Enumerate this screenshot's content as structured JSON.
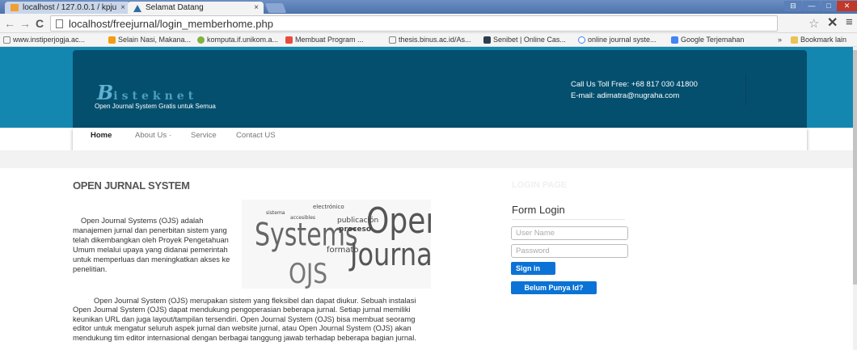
{
  "browser": {
    "tabs": [
      {
        "label": "localhost / 127.0.0.1 / kpju",
        "close": "×"
      },
      {
        "label": "Selamat Datang",
        "close": "×"
      }
    ],
    "window_controls": [
      "⊟",
      "—",
      "□",
      "✕"
    ],
    "url": "localhost/freejurnal/login_memberhome.php",
    "bookmarks": [
      {
        "label": "www.instiperjogja.ac...",
        "color": "#888888"
      },
      {
        "label": "Selain Nasi, Makana...",
        "color": "#f39c12"
      },
      {
        "label": "komputa.if.unikom.a...",
        "color": "#7cb342"
      },
      {
        "label": "Membuat Program ...",
        "color": "#e74c3c"
      },
      {
        "label": "thesis.binus.ac.id/As...",
        "color": "#888888"
      },
      {
        "label": "Senibet | Online Cas...",
        "color": "#2c3e50"
      },
      {
        "label": "online journal syste...",
        "color": "#4285f4"
      },
      {
        "label": "Google Terjemahan",
        "color": "#4285f4"
      }
    ],
    "bookmark_more": "»",
    "other_bookmarks": "Bookmark lain"
  },
  "header": {
    "logo_initial": "B",
    "logo_rest": "isteknet",
    "tagline": "Open Journal System Gratis untuk Semua",
    "phone": "Call Us Toll Free: +68 817 030 41800",
    "email": "E-mail: adimatra@nugraha.com"
  },
  "nav": {
    "home": "Home",
    "about": "About Us ·",
    "service": "Service",
    "contact": "Contact US"
  },
  "main": {
    "title": "OPEN JURNAL SYSTEM",
    "para1": "Open Journal Systems (OJS) adalah manajemen jurnal dan penerbitan sistem yang telah dikembangkan oleh Proyek Pengetahuan Umum melalui upaya yang didanai pemerintah untuk memperluas dan meningkatkan akses ke penelitian.",
    "para2": "Open Journal System (OJS) merupakan sistem yang fleksibel dan dapat diukur. Sebuah instalasi Open Journal System (OJS) dapat mendukung pengoperasian beberapa jurnal. Setiap jurnal memiliki keunikan URL dan juga layout/tampilan tersendiri. Open Journal System (OJS) bisa membuat seoramg editor untuk mengatur seluruh aspek jurnal dan website jurnal, atau Open Journal System (OJS) akan mendukung tim editor internasional dengan berbagai tanggung jawab terhadap beberapa bagian jurnal.",
    "wordcloud": [
      "Systems",
      "Open",
      "Journal",
      "OJS",
      "publicación",
      "proceso",
      "formato",
      "electrónico",
      "sistema",
      "accesibles"
    ]
  },
  "login": {
    "faded_heading": "LOGIN PAGE",
    "title": "Form Login",
    "username_placeholder": "User Name",
    "password_placeholder": "Password",
    "signin": "Sign in",
    "register": "Belum Punya Id?"
  }
}
